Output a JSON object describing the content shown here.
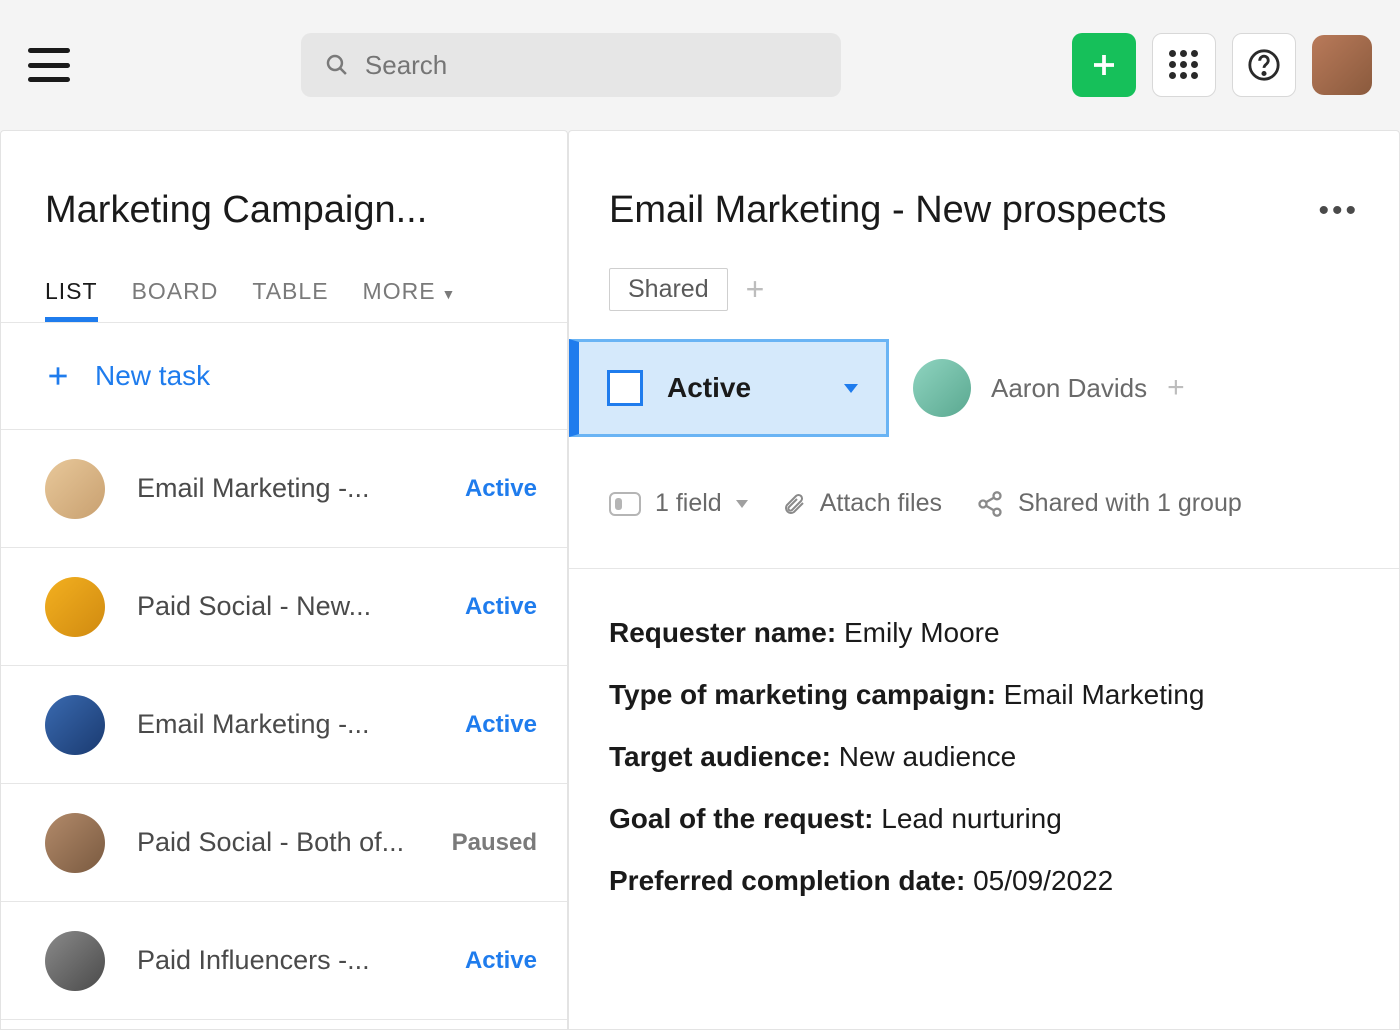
{
  "search": {
    "placeholder": "Search"
  },
  "left": {
    "title": "Marketing Campaign...",
    "tabs": [
      "LIST",
      "BOARD",
      "TABLE",
      "MORE"
    ],
    "active_tab": 0,
    "new_task_label": "New task",
    "tasks": [
      {
        "title": "Email Marketing -...",
        "status": "Active"
      },
      {
        "title": "Paid Social - New...",
        "status": "Active"
      },
      {
        "title": "Email Marketing -...",
        "status": "Active"
      },
      {
        "title": "Paid Social - Both of...",
        "status": "Paused"
      },
      {
        "title": "Paid Influencers -...",
        "status": "Active"
      }
    ]
  },
  "right": {
    "title": "Email Marketing - New prospects",
    "shared_label": "Shared",
    "status_label": "Active",
    "assignee": "Aaron Davids",
    "field_count_label": "1 field",
    "attach_label": "Attach files",
    "shared_with_label": "Shared with 1 group",
    "fields": {
      "requester_label": "Requester name:",
      "requester_value": "Emily Moore",
      "type_label": "Type of marketing campaign:",
      "type_value": "Email Marketing",
      "audience_label": "Target audience:",
      "audience_value": "New audience",
      "goal_label": "Goal of the request:",
      "goal_value": "Lead nurturing",
      "date_label": "Preferred completion date:",
      "date_value": "05/09/2022"
    }
  },
  "colors": {
    "accent": "#1f7ced",
    "green": "#16c05a"
  }
}
